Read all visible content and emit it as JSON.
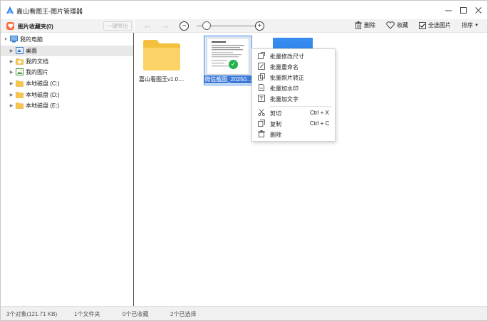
{
  "window": {
    "title": "嘉山看图王-图片管理器",
    "controls": {
      "minimize": "—",
      "maximize": "☐",
      "close": "✕"
    }
  },
  "left_toolbar": {
    "favorites_label": "图片收藏夹(0)",
    "export_label": "一键导出"
  },
  "sidebar": {
    "tree": [
      {
        "label": "我的电脑",
        "icon": "computer-icon",
        "level": 0,
        "expanded": true
      },
      {
        "label": "桌面",
        "icon": "desktop-icon",
        "level": 1,
        "selected": true
      },
      {
        "label": "我的文档",
        "icon": "documents-icon",
        "level": 1
      },
      {
        "label": "我的图片",
        "icon": "pictures-icon",
        "level": 1
      },
      {
        "label": "本地磁盘 (C:)",
        "icon": "folder-icon",
        "level": 1
      },
      {
        "label": "本地磁盘 (D:)",
        "icon": "folder-icon",
        "level": 1
      },
      {
        "label": "本地磁盘 (E:)",
        "icon": "folder-icon",
        "level": 1
      }
    ]
  },
  "main_toolbar": {
    "zoom_out": "−",
    "zoom_in": "+",
    "delete_label": "删除",
    "favorite_label": "收藏",
    "select_all_label": "全选图片",
    "sort_label": "排序"
  },
  "files": [
    {
      "name": "嘉山看图王v1.0....",
      "type": "folder"
    },
    {
      "name": "微信截图_20250...",
      "type": "image",
      "selected": true
    },
    {
      "name": "",
      "type": "image-blue"
    }
  ],
  "context_menu": {
    "items": [
      {
        "label": "批量修改尺寸",
        "icon": "resize-icon"
      },
      {
        "label": "批量重命名",
        "icon": "rename-icon"
      },
      {
        "label": "批量照片转正",
        "icon": "rotate-icon"
      },
      {
        "label": "批量加水印",
        "icon": "watermark-icon"
      },
      {
        "label": "批量加文字",
        "icon": "text-icon"
      },
      {
        "label": "剪切",
        "icon": "cut-icon",
        "shortcut": "Ctrl + X"
      },
      {
        "label": "复制",
        "icon": "copy-icon",
        "shortcut": "Ctrl + C"
      },
      {
        "label": "删除",
        "icon": "trash-icon"
      }
    ]
  },
  "statusbar": {
    "objects": "3个对象(121.71 KB)",
    "folders": "1个文件夹",
    "favorites": "0个已收藏",
    "selected": "2个已选择"
  },
  "colors": {
    "accent": "#3c78d8",
    "heart_badge": "#ff6a3d",
    "check_green": "#22b24c",
    "folder_yellow": "#f7c64a"
  }
}
